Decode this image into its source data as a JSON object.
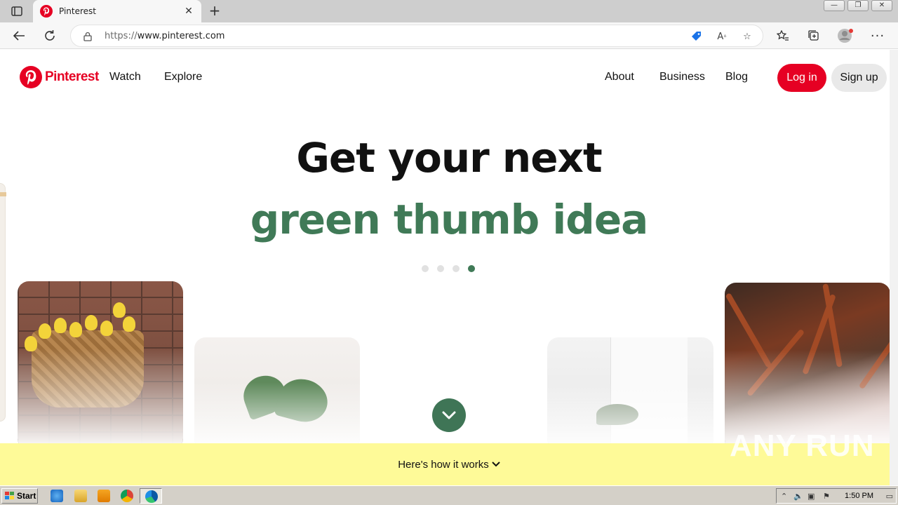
{
  "browser": {
    "tab": {
      "title": "Pinterest"
    },
    "url": {
      "scheme": "https://",
      "rest": "www.pinterest.com"
    }
  },
  "header": {
    "logo_text": "Pinterest",
    "nav_left": [
      "Watch",
      "Explore"
    ],
    "nav_right": [
      "About",
      "Business",
      "Blog"
    ],
    "login_label": "Log in",
    "signup_label": "Sign up"
  },
  "hero": {
    "line1": "Get your next",
    "line2": "green thumb idea",
    "carousel_total": 4,
    "carousel_active": 4
  },
  "how_it_works": {
    "label": "Here's how it works"
  },
  "watermark": {
    "text": "ANY RUN"
  },
  "taskbar": {
    "start_label": "Start",
    "clock": "1:50 PM"
  },
  "colors": {
    "brand": "#e60023",
    "accent_green": "#407a57",
    "banner_yellow": "#fefa98"
  }
}
